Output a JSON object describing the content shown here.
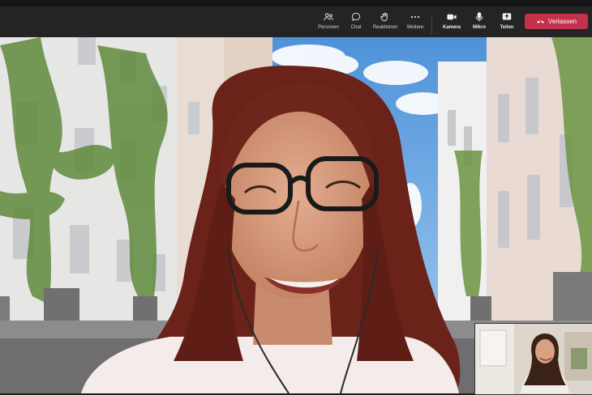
{
  "toolbar": {
    "people_label": "Personen",
    "chat_label": "Chat",
    "reactions_label": "Reaktionen",
    "more_label": "Weitere",
    "camera_label": "Kamera",
    "mic_label": "Mikro",
    "share_label": "Teilen",
    "leave_label": "Verlassen"
  },
  "icons": {
    "people": "people-icon",
    "chat": "chat-icon",
    "reactions": "reactions-icon",
    "more": "more-icon",
    "camera": "camera-icon",
    "mic": "microphone-icon",
    "share": "share-icon",
    "leave": "phone-hangup-icon"
  },
  "colors": {
    "toolbar_bg": "#242424",
    "leave_button": "#c4314b",
    "hair": "#6a2219",
    "skin": "#d9a184",
    "sky": "#5c9de0"
  }
}
